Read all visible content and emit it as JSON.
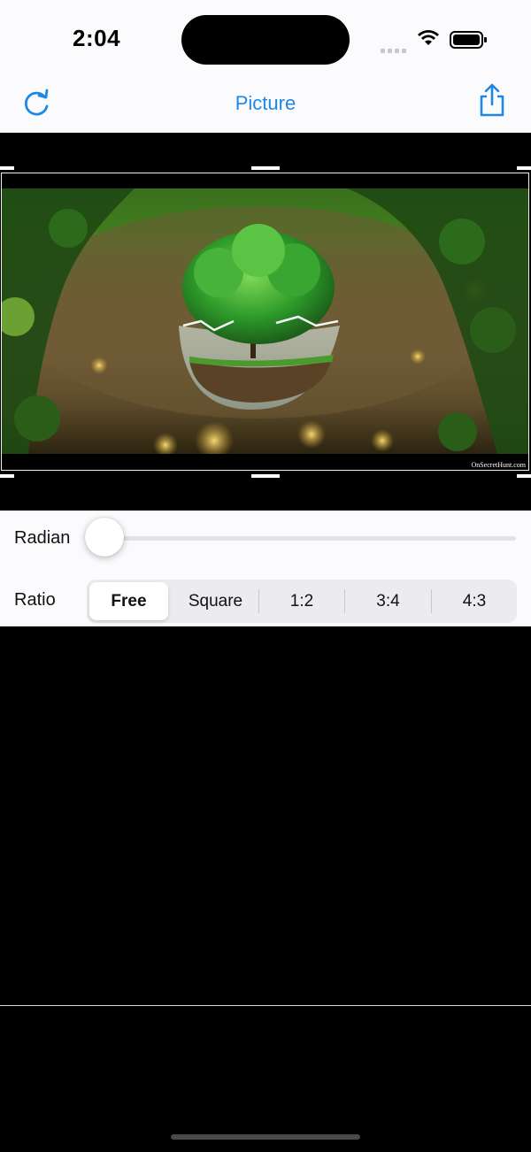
{
  "status_bar": {
    "time": "2:04",
    "icons": [
      "signal-icon",
      "wifi-icon",
      "battery-icon"
    ]
  },
  "nav": {
    "title": "Picture",
    "left_icon": "refresh-icon",
    "right_icon": "share-icon",
    "accent_color": "#1e88e5"
  },
  "photo": {
    "watermark": "OnSecretHunt.com"
  },
  "controls": {
    "radian_label": "Radian",
    "radian_value": 0,
    "ratio_label": "Ratio",
    "ratio_options": [
      "Free",
      "Square",
      "1:2",
      "3:4",
      "4:3"
    ],
    "ratio_selected": "Free"
  }
}
